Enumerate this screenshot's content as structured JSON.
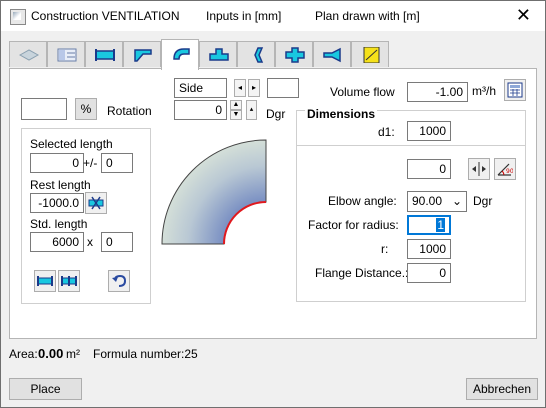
{
  "titlebar": {
    "app_title": "Construction VENTILATION",
    "inputs_unit": "Inputs in [mm]",
    "plan_unit": "Plan drawn with  [m]",
    "close_glyph": "✕"
  },
  "tabs": [
    {
      "icon": "gray-box-icon"
    },
    {
      "icon": "table-form-icon"
    },
    {
      "icon": "straight-duct-icon"
    },
    {
      "icon": "reducer-duct-icon"
    },
    {
      "icon": "elbow-duct-icon",
      "active": true
    },
    {
      "icon": "tee-duct-icon"
    },
    {
      "icon": "offset-duct-icon"
    },
    {
      "icon": "cross-duct-icon"
    },
    {
      "icon": "transition-duct-icon"
    },
    {
      "icon": "yellow-ruler-icon"
    }
  ],
  "left": {
    "percent_value": "",
    "percent_label": "%",
    "rotation_label": "Rotation",
    "selected_length_label": "Selected length",
    "selected_length_value": "0",
    "plusminus_label": "+/-",
    "tolerance_value": "0",
    "rest_length_label": "Rest length",
    "rest_length_value": "-1000.0",
    "std_length_label": "Std. length",
    "std_length_value": "6000",
    "times_label": "x",
    "count_value": "0"
  },
  "view": {
    "side_value": "Side",
    "extra_value": "",
    "degree_value": "0",
    "degree_unit": "Dgr"
  },
  "right": {
    "volume_flow_label": "Volume flow",
    "volume_flow_value": "-1.00",
    "volume_flow_unit": "m³/h",
    "dimensions_label": "Dimensions",
    "d1_label": "d1:",
    "d1_value": "1000",
    "angle_offset_value": "0",
    "elbow_angle_label": "Elbow angle:",
    "elbow_angle_value": "90.00",
    "elbow_angle_unit": "Dgr",
    "factor_radius_label": "Factor for radius:",
    "factor_radius_value": "1",
    "r_label": "r:",
    "r_value": "1000",
    "flange_label": "Flange Distance.:",
    "flange_value": "0"
  },
  "status": {
    "area_label": "Area:",
    "area_value": "0.00",
    "area_unit": "m²",
    "formula_label": "Formula number:25"
  },
  "buttons": {
    "place": "Place",
    "cancel": "Abbrechen"
  },
  "colors": {
    "accent": "#0078d7",
    "duct_cyan": "#19c8e0",
    "elbow_blue": "#3a4fb0",
    "elbow_edge_red": "#e0191e"
  }
}
